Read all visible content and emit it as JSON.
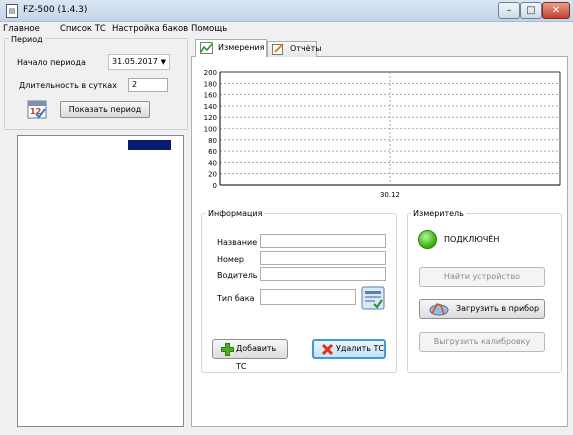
{
  "window": {
    "title": "FZ-500 (1.4.3)"
  },
  "menu": [
    "Главное",
    "Список ТС",
    "Настройка баков",
    "Помощь"
  ],
  "period": {
    "group_title": "Период",
    "start_label": "Начало периода",
    "start_value": "31.05.2017",
    "duration_label": "Длительность в сутках",
    "duration_value": "2",
    "calendar_badge": "12",
    "show_button": "Показать период"
  },
  "tabs": [
    {
      "label": "Измерения",
      "active": true
    },
    {
      "label": "Отчёты",
      "active": false
    }
  ],
  "chart_data": {
    "type": "line",
    "y_ticks": [
      "200",
      "180",
      "160",
      "140",
      "120",
      "100",
      "80",
      "60",
      "40",
      "20",
      "0"
    ],
    "ylim": [
      0,
      200
    ],
    "x_ticks": [
      "30.12"
    ],
    "grid": true,
    "series": []
  },
  "info": {
    "group_title": "Информация",
    "name_label": "Название",
    "number_label": "Номер",
    "driver_label": "Водитель",
    "tank_type_label": "Тип бака",
    "add_button": "Добавить ТС",
    "delete_button": "Удалить ТС"
  },
  "meter": {
    "group_title": "Измеритель",
    "status": "ПОДКЛЮЧЁН",
    "status_color": "#3fba16",
    "find_button": "Найти устройство",
    "upload_button": "Загрузить в прибор",
    "download_button": "Выгрузить калибровку"
  }
}
